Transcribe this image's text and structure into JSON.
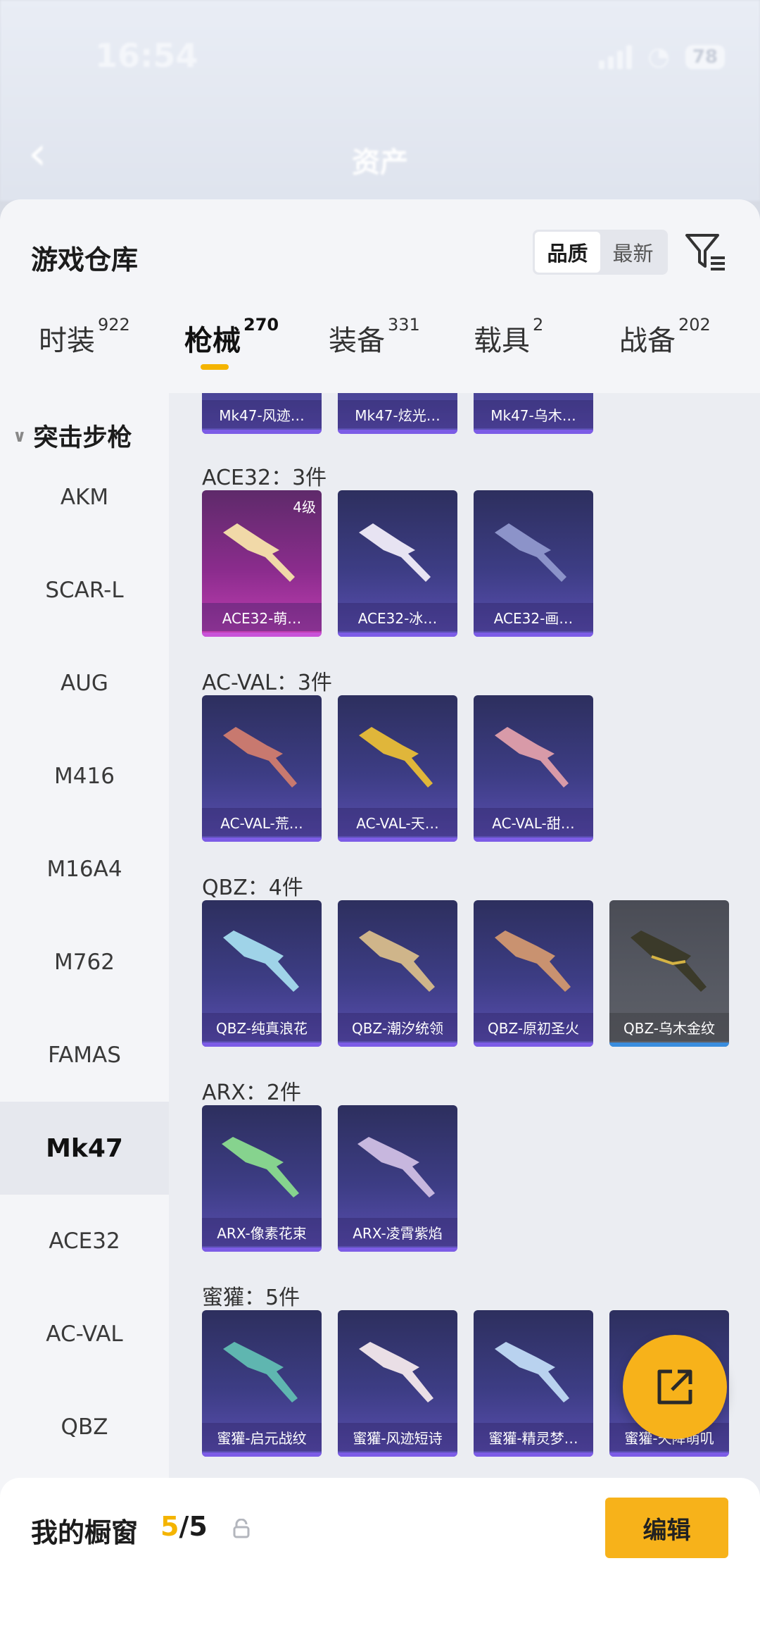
{
  "status_bar": {
    "time": "16:54",
    "battery": "78"
  },
  "background_page": {
    "title": "资产"
  },
  "sheet": {
    "title": "游戏仓库",
    "sort_options": [
      "品质",
      "最新"
    ],
    "tabs": [
      {
        "label": "时装",
        "count": "922"
      },
      {
        "label": "枪械",
        "count": "270"
      },
      {
        "label": "装备",
        "count": "331"
      },
      {
        "label": "载具",
        "count": "2"
      },
      {
        "label": "战备",
        "count": "202"
      }
    ],
    "active_tab": 1
  },
  "sidebar": {
    "group": "突击步枪",
    "items": [
      "AKM",
      "SCAR-L",
      "AUG",
      "M416",
      "M16A4",
      "M762",
      "FAMAS",
      "Mk47",
      "ACE32",
      "AC-VAL",
      "QBZ"
    ],
    "active": "Mk47"
  },
  "content": {
    "partial_row": [
      "Mk47-风迹…",
      "Mk47-炫光…",
      "Mk47-乌木…"
    ],
    "groups": [
      {
        "label": "ACE32：3件",
        "items": [
          {
            "name": "ACE32-萌…",
            "tier": "4级",
            "style": "pink"
          },
          {
            "name": "ACE32-冰…"
          },
          {
            "name": "ACE32-画…"
          }
        ]
      },
      {
        "label": "AC-VAL：3件",
        "items": [
          {
            "name": "AC-VAL-荒…"
          },
          {
            "name": "AC-VAL-天…"
          },
          {
            "name": "AC-VAL-甜…"
          }
        ]
      },
      {
        "label": "QBZ：4件",
        "items": [
          {
            "name": "QBZ-纯真浪花"
          },
          {
            "name": "QBZ-潮汐统领"
          },
          {
            "name": "QBZ-原初圣火"
          },
          {
            "name": "QBZ-乌木金纹",
            "style": "grey"
          }
        ]
      },
      {
        "label": "ARX：2件",
        "items": [
          {
            "name": "ARX-像素花束"
          },
          {
            "name": "ARX-凌霄紫焰"
          }
        ]
      },
      {
        "label": "蜜獾：5件",
        "items": [
          {
            "name": "蜜獾-启元战纹"
          },
          {
            "name": "蜜獾-风迹短诗"
          },
          {
            "name": "蜜獾-精灵梦…"
          },
          {
            "name": "蜜獾-天降萌叽"
          }
        ]
      }
    ]
  },
  "bottom_bar": {
    "label": "我的橱窗",
    "count_current": "5",
    "count_total": "/5",
    "edit_label": "编辑"
  },
  "colors": {
    "accent": "#f7b21a",
    "card_bg": "#3d3d85",
    "card_pink": "#8b2c8d",
    "card_grey": "#575a63"
  }
}
